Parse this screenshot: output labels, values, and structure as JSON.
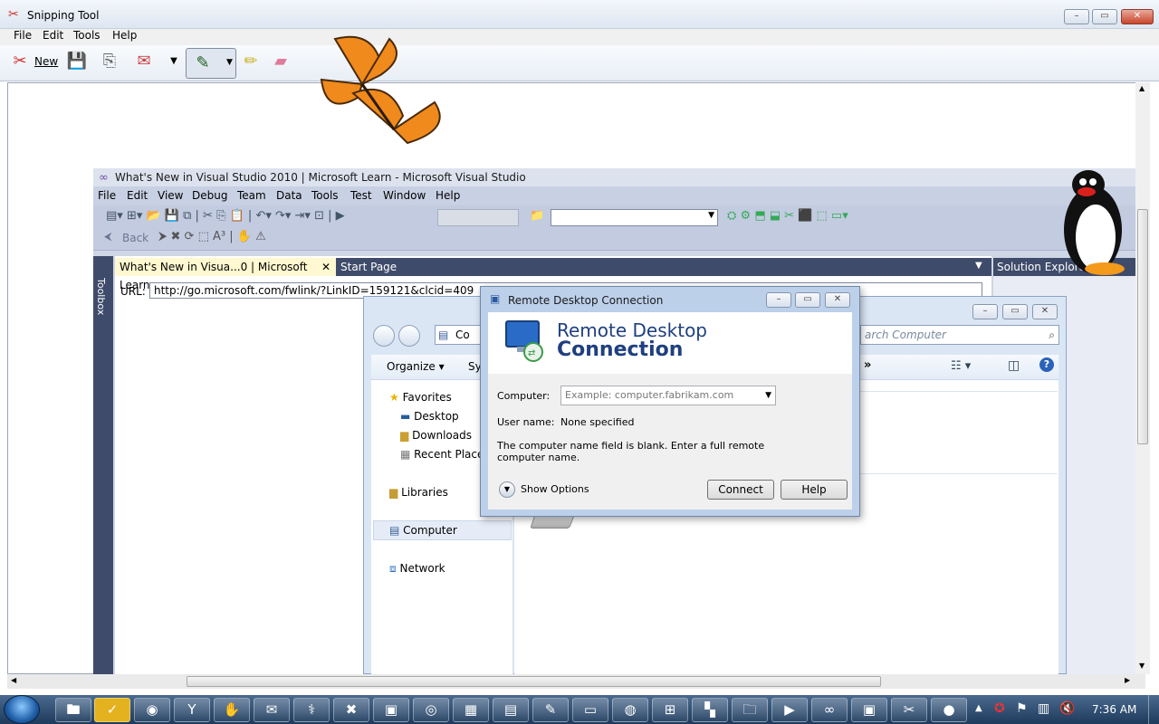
{
  "snipping_tool": {
    "title": "Snipping Tool",
    "menu": [
      "File",
      "Edit",
      "Tools",
      "Help"
    ],
    "toolbar": {
      "new_label": "New"
    }
  },
  "vs": {
    "title": "What's New in Visual Studio 2010 | Microsoft Learn - Microsoft Visual Studio",
    "menu": [
      "File",
      "Edit",
      "View",
      "Debug",
      "Team",
      "Data",
      "Tools",
      "Test",
      "Window",
      "Help"
    ],
    "back_label": "Back",
    "toolbox_label": "Toolbox",
    "tabs": [
      "What's New in Visua...0 | Microsoft Learn",
      "Start Page"
    ],
    "url_label": "URL:",
    "url_value": "http://go.microsoft.com/fwlink/?LinkID=159121&clcid=409",
    "solution_explorer": "Solution Explorer"
  },
  "explorer": {
    "search_placeholder": "arch Computer",
    "address_partial": "Co",
    "organize": "Organize",
    "cmd_partial": "Sy",
    "nav": {
      "favorites": "Favorites",
      "desktop": "Desktop",
      "downloads": "Downloads",
      "recent": "Recent Places",
      "libraries": "Libraries",
      "computer": "Computer",
      "network": "Network"
    }
  },
  "rdc": {
    "window_title": "Remote Desktop Connection",
    "header_line1": "Remote Desktop",
    "header_line2": "Connection",
    "computer_label": "Computer:",
    "computer_placeholder": "Example: computer.fabrikam.com",
    "username_label": "User name:",
    "username_value": "None specified",
    "message": "The computer name field is blank. Enter a full remote computer name.",
    "show_options": "Show Options",
    "connect": "Connect",
    "help": "Help"
  },
  "taskbar": {
    "clock": "7:36 AM"
  },
  "colors": {
    "taskbar": "#1e3a5c",
    "vs_chrome": "#3f4b6a",
    "rdc_frame": "#bcd0ea"
  }
}
